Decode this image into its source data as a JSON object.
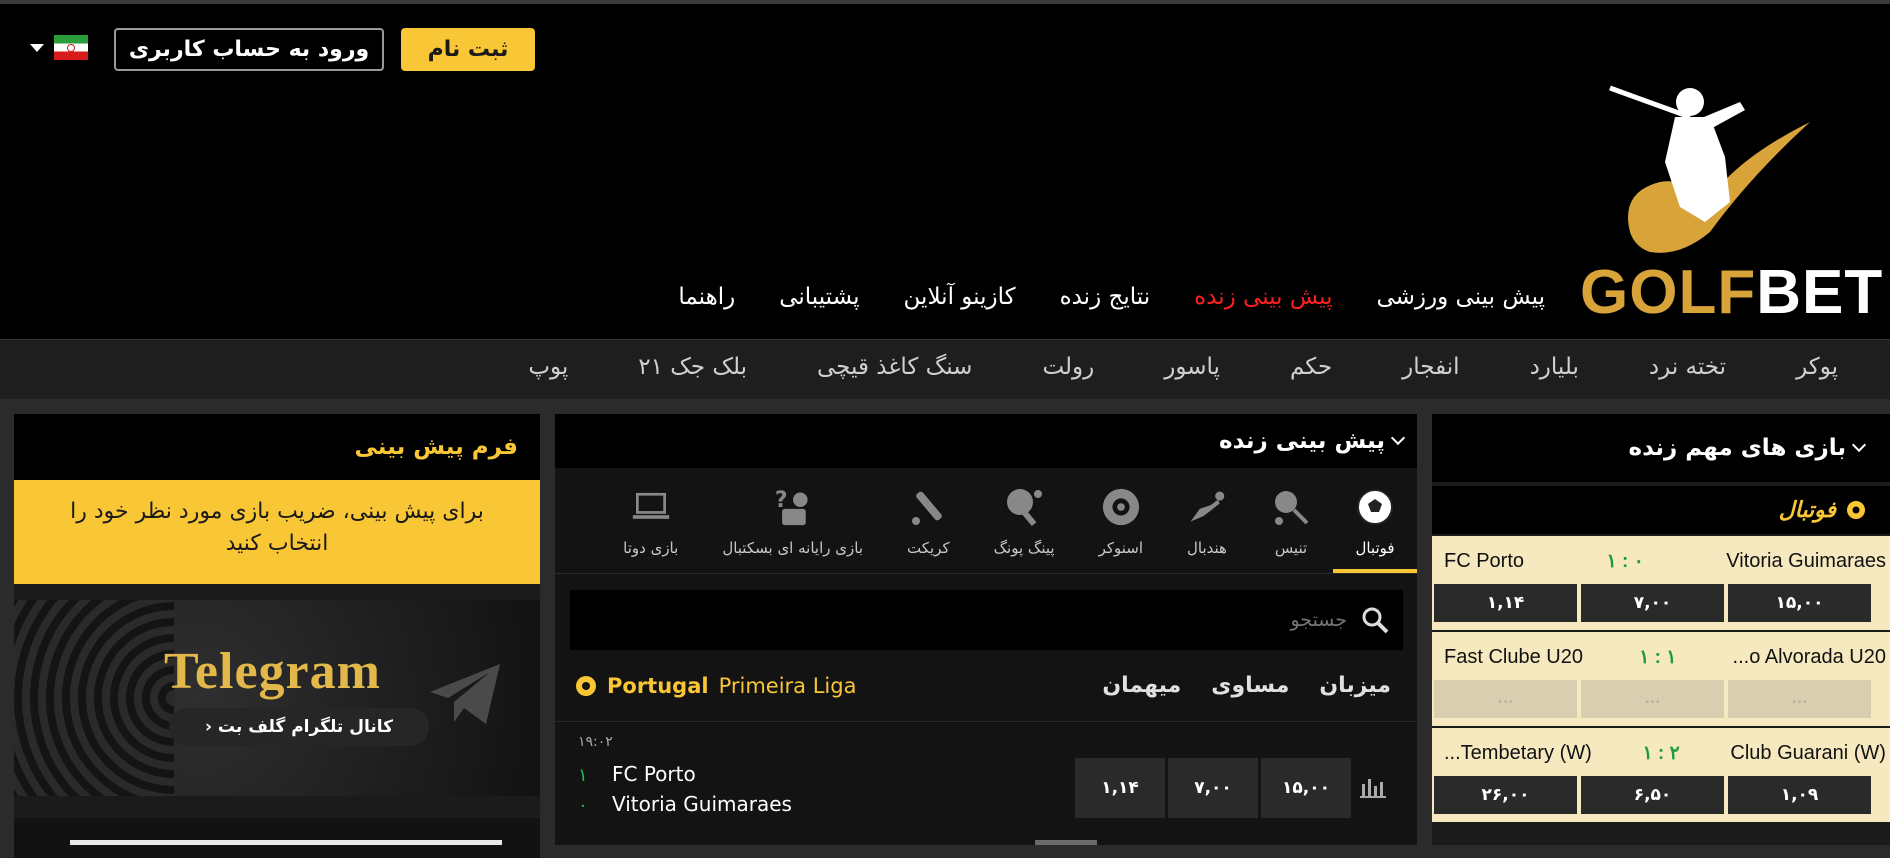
{
  "header": {
    "register_label": "ثبت نام",
    "login_label": "ورود به حساب کاربری",
    "logo_text_1": "GOLF",
    "logo_text_2": "BET"
  },
  "main_nav": [
    "پیش بینی ورزشی",
    "پیش بینی زنده",
    "نتایج زنده",
    "کازینو آنلاین",
    "پشتیبانی",
    "راهنما"
  ],
  "sub_nav": [
    "پوکر",
    "تخته نرد",
    "بلیارد",
    "انفجار",
    "حکم",
    "پاسور",
    "رولت",
    "سنگ کاغذ قیچی",
    "بلک جک ۲۱",
    "پوپ"
  ],
  "bet_form": {
    "title": "فرم پیش بینی",
    "note": "برای پیش بینی، ضریب بازی مورد نظر خود را انتخاب کنید"
  },
  "telegram_banner": {
    "title": "Telegram",
    "subtitle": "› کانال تلگرام گلف بت"
  },
  "live_betting": {
    "title": "پیش بینی زنده",
    "sports": [
      {
        "label": "فوتبال",
        "icon": "soccer-ball-icon"
      },
      {
        "label": "تنیس",
        "icon": "tennis-racket-icon"
      },
      {
        "label": "هندبال",
        "icon": "handball-icon"
      },
      {
        "label": "اسنوکر",
        "icon": "snooker-icon"
      },
      {
        "label": "پینگ پونگ",
        "icon": "ping-pong-icon"
      },
      {
        "label": "کریکت",
        "icon": "cricket-bat-icon"
      },
      {
        "label": "بازی رایانه ای بسکتبال",
        "icon": "esports-basketball-icon"
      },
      {
        "label": "بازی دوتا",
        "icon": "laptop-icon"
      }
    ],
    "search_placeholder": "جستجو",
    "league_country": "Portugal",
    "league_name": "Primeira Liga",
    "columns": {
      "home": "میزبان",
      "draw": "مساوی",
      "away": "میهمان"
    },
    "match": {
      "time": "۱۹:۰۲",
      "home": "FC Porto",
      "away": "Vitoria Guimaraes",
      "home_score": "۱",
      "away_score": "۰",
      "odds": [
        "۱,۱۴",
        "۷,۰۰",
        "۱۵,۰۰"
      ]
    }
  },
  "important_live": {
    "title": "بازی های مهم زنده",
    "sport": "فوتبال",
    "matches": [
      {
        "left": "FC Porto",
        "score": "۱ : ۰",
        "right": "Vitoria Guimaraes",
        "odds": [
          "۱,۱۴",
          "۷,۰۰",
          "۱۵,۰۰"
        ],
        "disabled": false
      },
      {
        "left": "Fast Clube U20",
        "score": "۱ : ۱",
        "right": "...o Alvorada U20",
        "odds": [
          "...",
          "...",
          "..."
        ],
        "disabled": true
      },
      {
        "left": "...Tembetary (W)",
        "score": "۱ : ۲",
        "right": "Club Guarani (W)",
        "odds": [
          "۲۶,۰۰",
          "۶,۵۰",
          "۱,۰۹"
        ],
        "disabled": false
      }
    ]
  }
}
